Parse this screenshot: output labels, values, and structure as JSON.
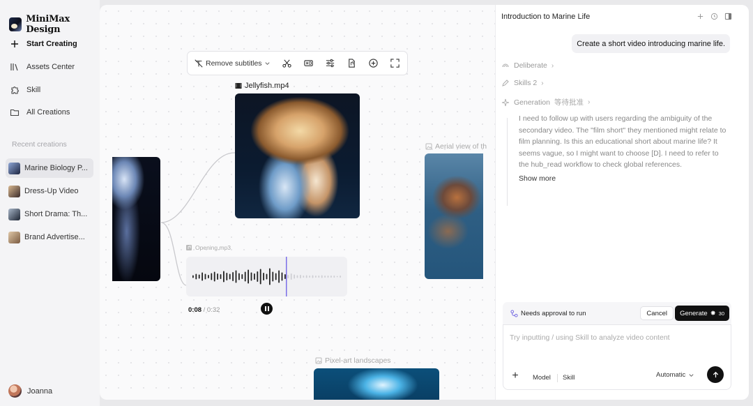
{
  "app": {
    "brand": "MiniMax Design"
  },
  "nav": {
    "start_creating": "Start Creating",
    "assets_center": "Assets Center",
    "skill": "Skill",
    "all_creations": "All Creations"
  },
  "recent": {
    "label": "Recent creations",
    "items": [
      {
        "label": "Marine Biology P...",
        "active": true,
        "color": "#3b4a6e"
      },
      {
        "label": "Dress-Up Video",
        "active": false,
        "color": "#6a5a4a"
      },
      {
        "label": "Short Drama: Th...",
        "active": false,
        "color": "#2c3848"
      },
      {
        "label": "Brand Advertise...",
        "active": false,
        "color": "#8a6a4e"
      }
    ]
  },
  "user": {
    "name": "Joanna"
  },
  "toolbar": {
    "remove_subtitles": "Remove subtitles",
    "icons": [
      "scissors-icon",
      "hd-icon",
      "sliders-icon",
      "file-audio-icon",
      "add-comment-icon",
      "fullscreen-icon"
    ]
  },
  "canvas": {
    "main_video_label": "Jellyfish.mp4",
    "audio_label": "Opening.mp3",
    "audio_time_current": "0:08",
    "audio_time_total": "/ 0:32",
    "audio_progress": 0.25,
    "aerial_label": "Aerial view of th",
    "pixel_label": "Pixel-art landscapes"
  },
  "panel": {
    "title": "Introduction to Marine Life",
    "user_message": "Create a short video introducing marine life.",
    "steps": {
      "deliberate": "Deliberate",
      "skills": "Skills 2",
      "generation": "Generation",
      "generation_status": "等待批准"
    },
    "thought": "I need to follow up with users regarding the ambiguity of the secondary video. The \"film short\" they mentioned might relate to film planning. Is this an educational short about marine life? It seems vague, so I might want to choose [D]. I need to refer to the hub_read workflow to check global references.",
    "show_more": "Show more",
    "approval_text": "Needs approval to run",
    "cancel": "Cancel",
    "generate": "Generate",
    "generate_cost": "30",
    "composer_placeholder": "Try inputting / using Skill to analyze video content",
    "model": "Model",
    "skill": "Skill",
    "mode": "Automatic"
  },
  "colors": {
    "accent": "#7b6ee8",
    "primary_button": "#111111"
  }
}
